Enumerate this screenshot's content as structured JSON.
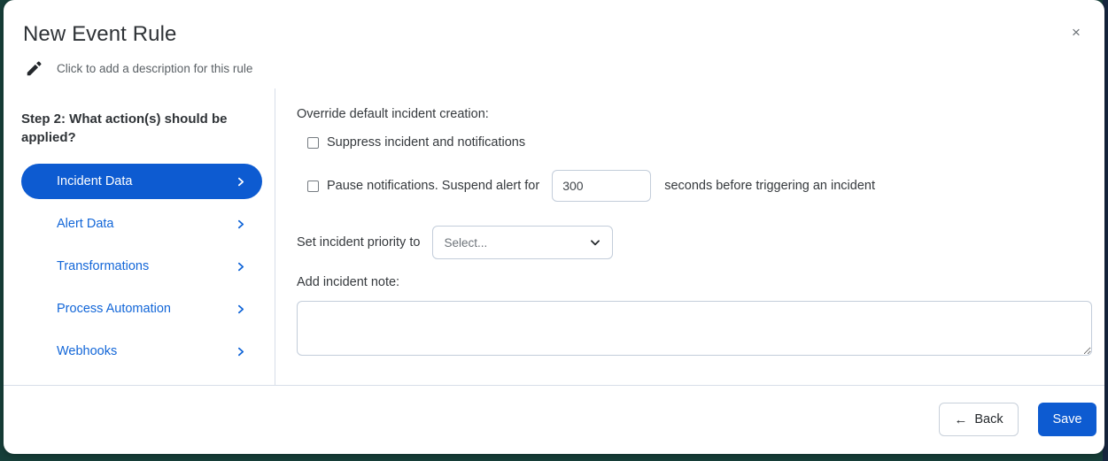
{
  "modal": {
    "title": "New Event Rule",
    "description_placeholder": "Click to add a description for this rule",
    "close_label": "×"
  },
  "sidebar": {
    "step_heading": "Step 2: What action(s) should be applied?",
    "items": [
      {
        "label": "Incident Data",
        "active": true
      },
      {
        "label": "Alert Data",
        "active": false
      },
      {
        "label": "Transformations",
        "active": false
      },
      {
        "label": "Process Automation",
        "active": false
      },
      {
        "label": "Webhooks",
        "active": false
      }
    ]
  },
  "panel": {
    "override_label": "Override default incident creation:",
    "suppress_label": "Suppress incident and notifications",
    "pause_label": "Pause notifications. Suspend alert for",
    "suspend_value": "300",
    "suspend_suffix": "seconds before triggering an incident",
    "priority_label": "Set incident priority to",
    "priority_value": "Select...",
    "note_label": "Add incident note:",
    "note_value": ""
  },
  "footer": {
    "back_label": "Back",
    "back_arrow": "←",
    "save_label": "Save"
  },
  "colors": {
    "accent_blue": "#0d5bd1",
    "link_blue": "#1266d8",
    "border": "#c3cdda"
  }
}
